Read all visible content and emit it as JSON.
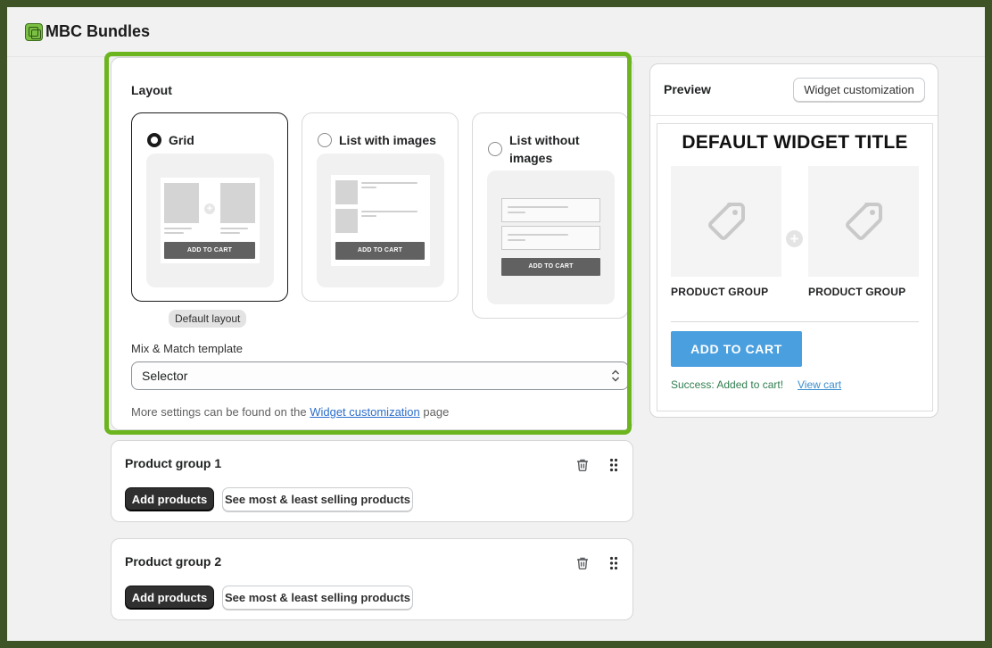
{
  "app": {
    "title": "MBC Bundles"
  },
  "layout": {
    "heading": "Layout",
    "options": [
      {
        "label": "Grid",
        "selected": true
      },
      {
        "label": "List with images",
        "selected": false
      },
      {
        "label": "List without images",
        "selected": false
      }
    ],
    "thumb_button": "ADD TO CART",
    "default_badge": "Default layout",
    "template_label": "Mix & Match template",
    "template_value": "Selector",
    "help_prefix": "More settings can be found on the",
    "help_link": "Widget customization",
    "help_suffix": "page"
  },
  "groups": [
    {
      "title": "Product group 1",
      "add_label": "Add products",
      "selling_label": "See most & least selling products"
    },
    {
      "title": "Product group 2",
      "add_label": "Add products",
      "selling_label": "See most & least selling products"
    }
  ],
  "preview": {
    "heading": "Preview",
    "customize_button": "Widget customization",
    "widget_title": "DEFAULT WIDGET TITLE",
    "products": [
      "PRODUCT GROUP",
      "PRODUCT GROUP"
    ],
    "add_to_cart": "ADD TO CART",
    "success_text": "Success: Added to cart!",
    "view_cart": "View cart"
  },
  "colors": {
    "highlight": "#6cb51f",
    "add_to_cart": "#4a9fdf",
    "success": "#2e7d4f",
    "link": "#2c6ecb"
  },
  "icons": [
    "app-logo-icon",
    "radio-icon",
    "chevron-updown-icon",
    "trash-icon",
    "drag-handle-icon",
    "tag-icon",
    "plus-icon"
  ]
}
